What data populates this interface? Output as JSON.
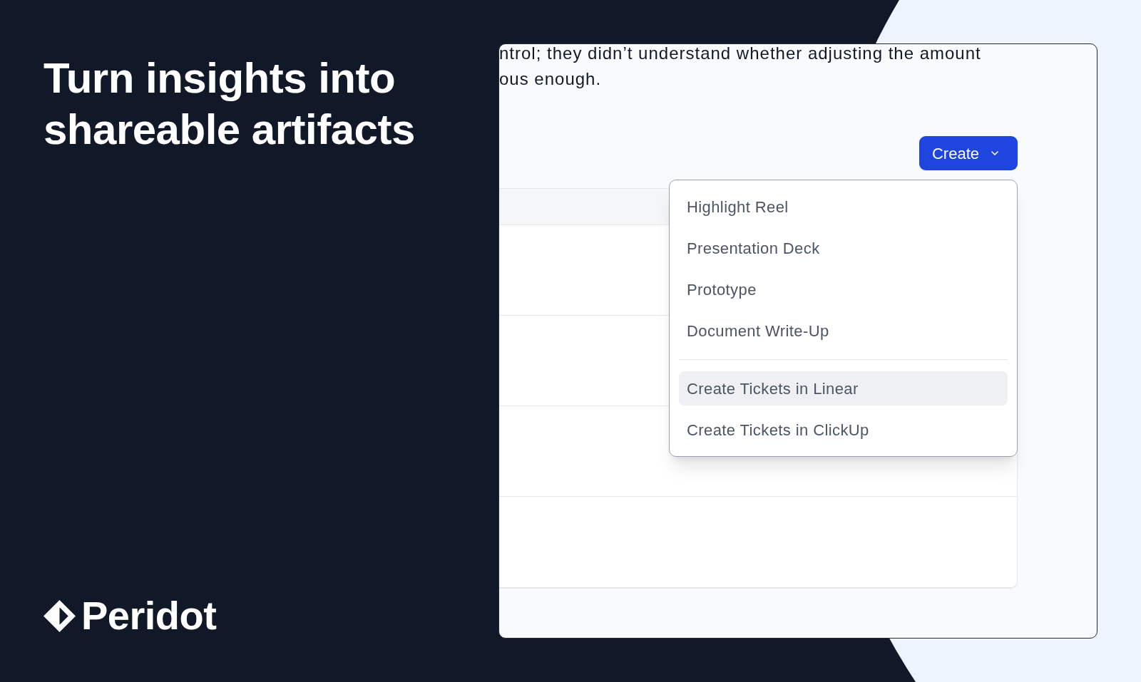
{
  "headline": "Turn insights into shareable artifacts",
  "brand": {
    "name": "Peridot"
  },
  "window": {
    "paragraph_lines": [
      "ntrol; they didn’t understand whether adjusting the amount",
      "ous enough."
    ],
    "create_button": {
      "label": "Create",
      "expanded": true
    },
    "menu": {
      "sections": [
        {
          "items": [
            {
              "label": "Highlight Reel",
              "highlighted": false
            },
            {
              "label": "Presentation Deck",
              "highlighted": false
            },
            {
              "label": "Prototype",
              "highlighted": false
            },
            {
              "label": "Document Write-Up",
              "highlighted": false
            }
          ]
        },
        {
          "items": [
            {
              "label": "Create Tickets in Linear",
              "highlighted": true
            },
            {
              "label": "Create Tickets in ClickUp",
              "highlighted": false
            }
          ]
        }
      ]
    }
  }
}
